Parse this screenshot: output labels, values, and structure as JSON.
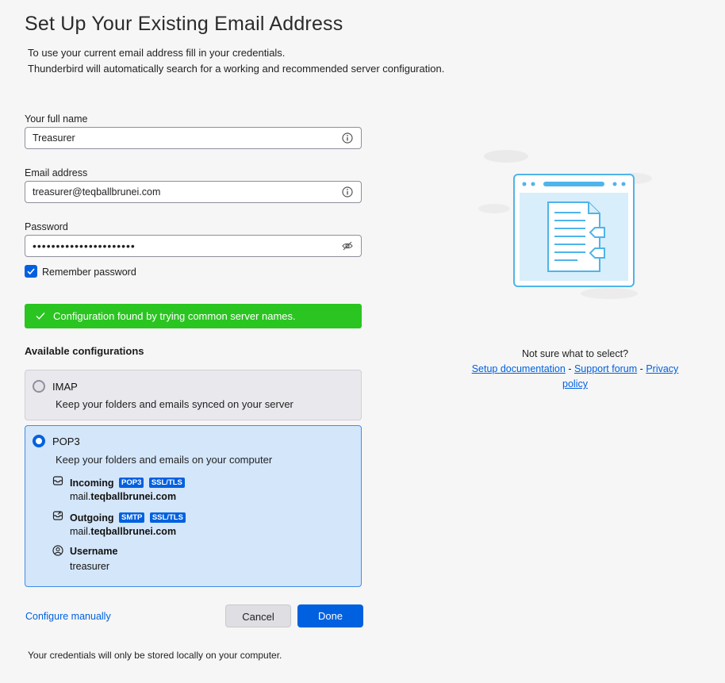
{
  "header": {
    "title": "Set Up Your Existing Email Address",
    "subtitle_line1": "To use your current email address fill in your credentials.",
    "subtitle_line2": "Thunderbird will automatically search for a working and recommended server configuration."
  },
  "form": {
    "name_label": "Your full name",
    "name_value": "Treasurer",
    "email_label": "Email address",
    "email_value": "treasurer@teqballbrunei.com",
    "password_label": "Password",
    "password_value": "••••••••••••••••••••••",
    "remember_label": "Remember password",
    "remember_checked": true
  },
  "status": {
    "message": "Configuration found by trying common server names.",
    "color": "#2ac520"
  },
  "configs": {
    "heading": "Available configurations",
    "imap": {
      "title": "IMAP",
      "description": "Keep your folders and emails synced on your server",
      "selected": false
    },
    "pop3": {
      "title": "POP3",
      "description": "Keep your folders and emails on your computer",
      "selected": true,
      "incoming_label": "Incoming",
      "incoming_badges": [
        "POP3",
        "SSL/TLS"
      ],
      "incoming_host_prefix": "mail.",
      "incoming_host_domain": "teqballbrunei.com",
      "outgoing_label": "Outgoing",
      "outgoing_badges": [
        "SMTP",
        "SSL/TLS"
      ],
      "outgoing_host_prefix": "mail.",
      "outgoing_host_domain": "teqballbrunei.com",
      "username_label": "Username",
      "username_value": "treasurer"
    }
  },
  "actions": {
    "configure_manually": "Configure manually",
    "cancel": "Cancel",
    "done": "Done"
  },
  "footer": {
    "note": "Your credentials will only be stored locally on your computer."
  },
  "help": {
    "question": "Not sure what to select?",
    "setup_docs": "Setup documentation",
    "separator": "-",
    "support_forum": "Support forum",
    "privacy_policy": "Privacy policy"
  },
  "colors": {
    "accent": "#0061e0",
    "selected_card": "#d4e6fa",
    "illustration": "#4fb4ea"
  }
}
